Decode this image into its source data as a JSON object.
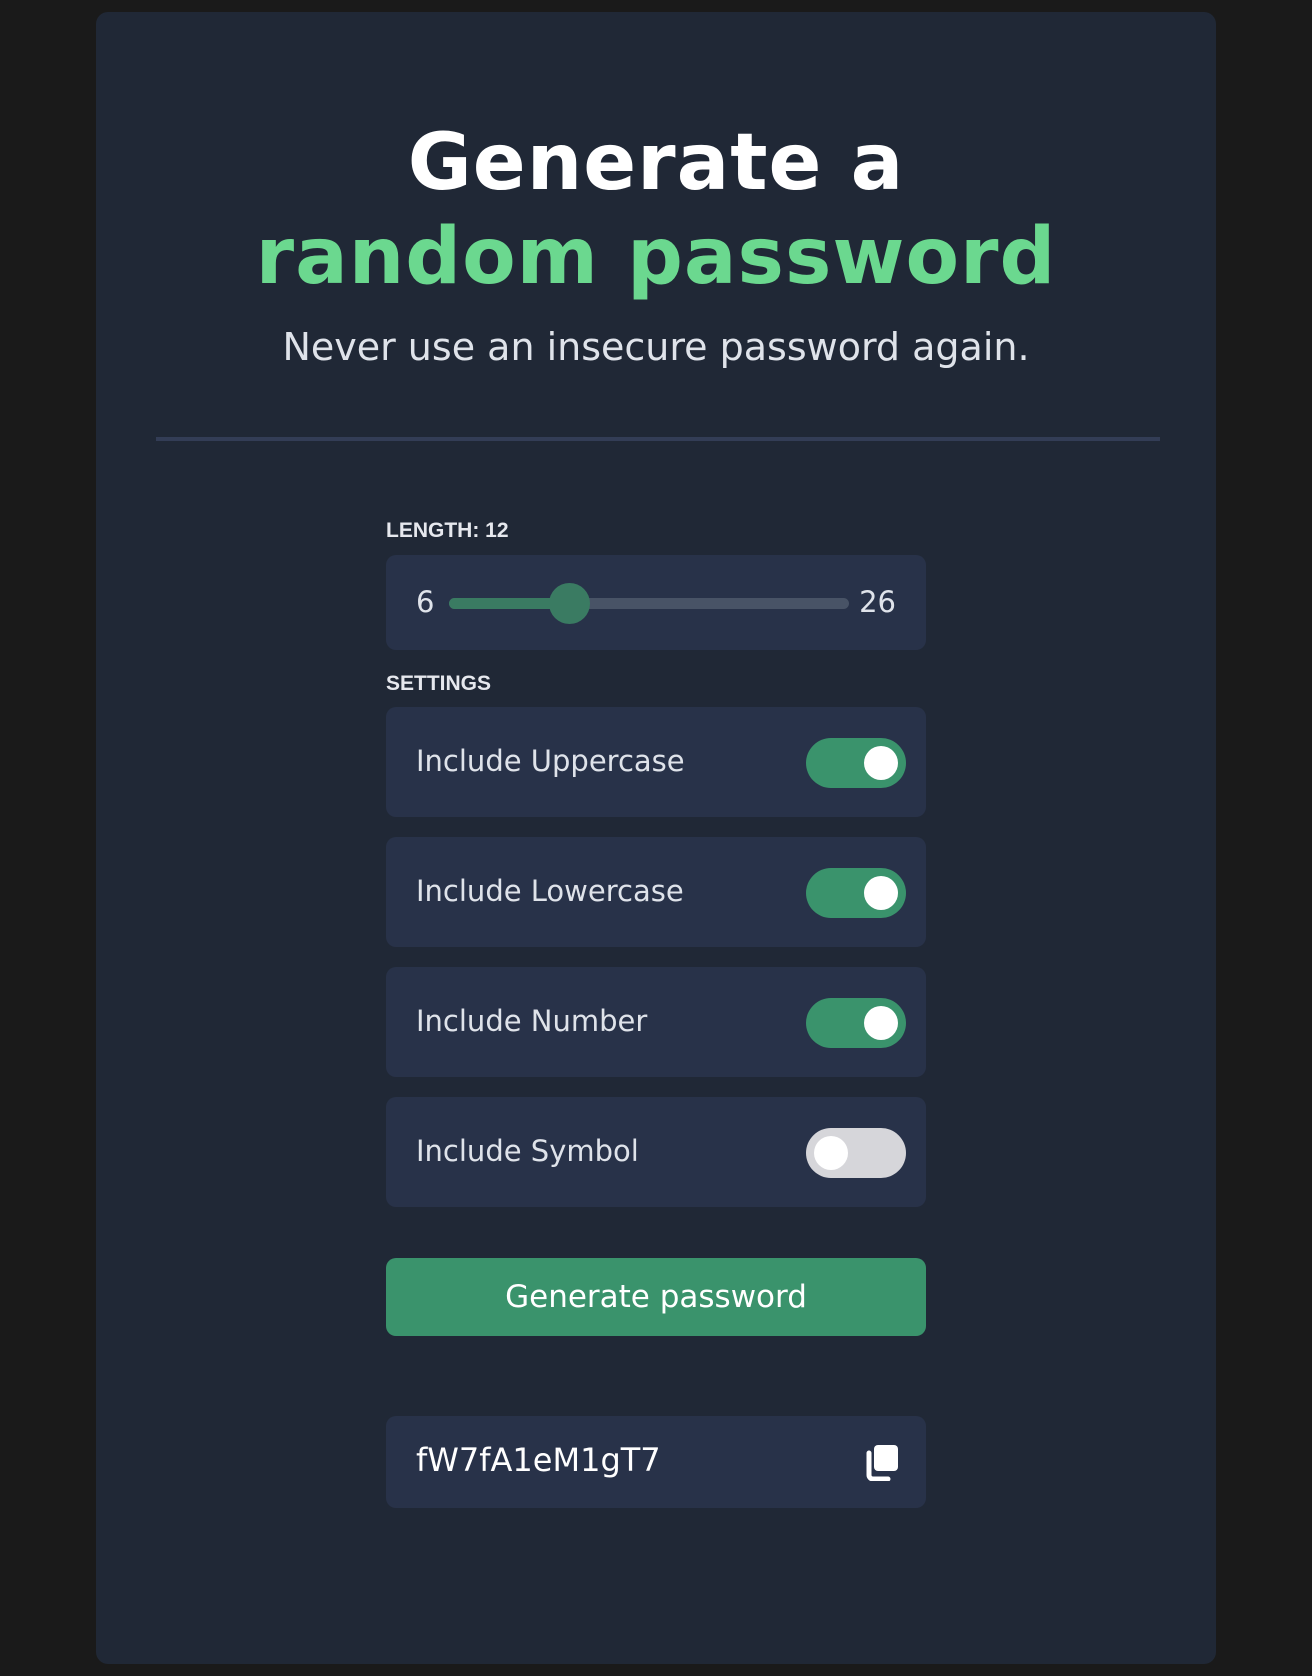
{
  "header": {
    "title_line1": "Generate a",
    "title_line2": "random password",
    "subtitle": "Never use an insecure password again.",
    "accent_color": "#6bd88f"
  },
  "length": {
    "label": "LENGTH: 12",
    "value": 12,
    "min": 6,
    "max": 26,
    "min_label": "6",
    "max_label": "26"
  },
  "settings": {
    "label": "SETTINGS",
    "options": [
      {
        "label": "Include Uppercase",
        "checked": true
      },
      {
        "label": "Include Lowercase",
        "checked": true
      },
      {
        "label": "Include Number",
        "checked": true
      },
      {
        "label": "Include Symbol",
        "checked": false
      }
    ]
  },
  "generate_button": {
    "label": "Generate password",
    "color": "#3a936c"
  },
  "output": {
    "password": "fW7fA1eM1gT7",
    "copy_icon": "copy-icon"
  }
}
